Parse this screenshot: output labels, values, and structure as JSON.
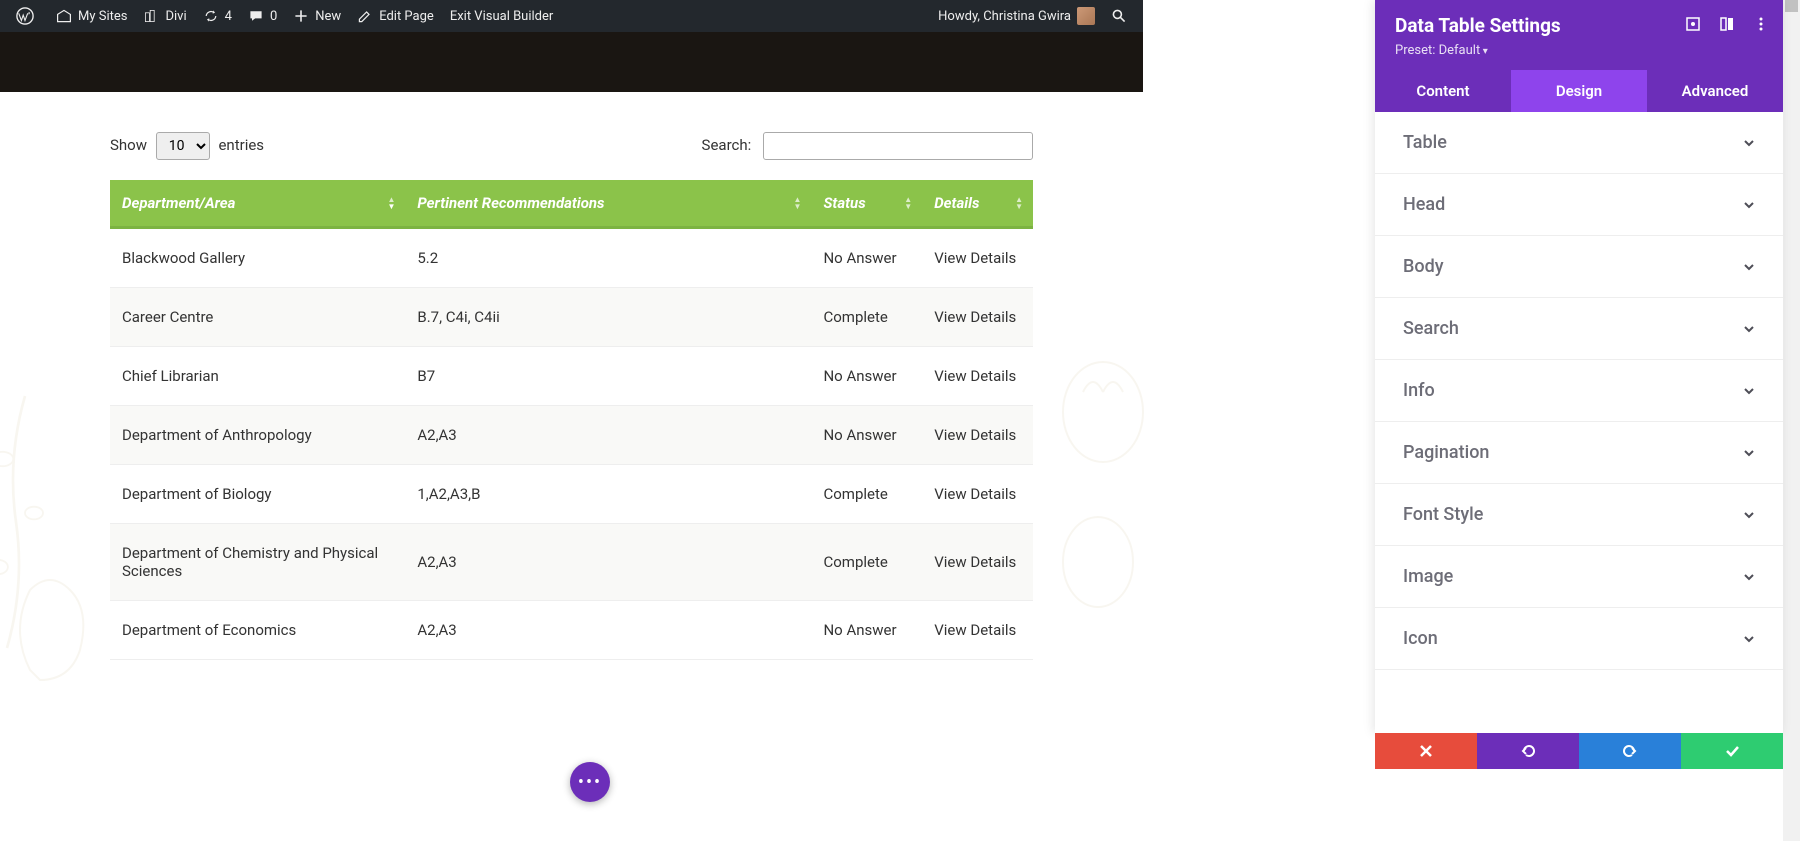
{
  "adminbar": {
    "mysites": "My Sites",
    "divi": "Divi",
    "updates": "4",
    "comments": "0",
    "new": "New",
    "editpage": "Edit Page",
    "exitvb": "Exit Visual Builder",
    "howdy": "Howdy, Christina Gwira"
  },
  "controls": {
    "show": "Show",
    "entries": "entries",
    "select_value": "10",
    "search_label": "Search:"
  },
  "table": {
    "headers": {
      "dept": "Department/Area",
      "rec": "Pertinent Recommendations",
      "status": "Status",
      "details": "Details"
    },
    "rows": [
      {
        "dept": "Blackwood Gallery",
        "rec": "5.2",
        "status": "No Answer",
        "details": "View Details"
      },
      {
        "dept": "Career Centre",
        "rec": "B.7, C4i, C4ii",
        "status": "Complete",
        "details": "View Details"
      },
      {
        "dept": "Chief Librarian",
        "rec": "B7",
        "status": "No Answer",
        "details": "View Details"
      },
      {
        "dept": "Department of Anthropology",
        "rec": "A2,A3",
        "status": "No Answer",
        "details": "View Details"
      },
      {
        "dept": "Department of Biology",
        "rec": "1,A2,A3,B",
        "status": "Complete",
        "details": "View Details"
      },
      {
        "dept": "Department of Chemistry and Physical Sciences",
        "rec": "A2,A3",
        "status": "Complete",
        "details": "View Details"
      },
      {
        "dept": "Department of Economics",
        "rec": "A2,A3",
        "status": "No Answer",
        "details": "View Details"
      }
    ]
  },
  "panel": {
    "title": "Data Table Settings",
    "preset": "Preset: Default",
    "tabs": {
      "content": "Content",
      "design": "Design",
      "advanced": "Advanced"
    },
    "sections": [
      "Table",
      "Head",
      "Body",
      "Search",
      "Info",
      "Pagination",
      "Font Style",
      "Image",
      "Icon"
    ]
  }
}
